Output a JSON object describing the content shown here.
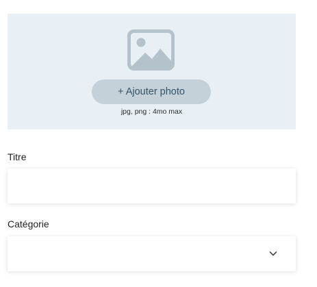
{
  "upload": {
    "icon": "image-placeholder-icon",
    "button_label": "+ Ajouter photo",
    "hint": "jpg, png : 4mo max"
  },
  "fields": {
    "title": {
      "label": "Titre",
      "value": ""
    },
    "category": {
      "label": "Catégorie",
      "selected": "",
      "icon": "chevron-down-icon"
    }
  },
  "colors": {
    "upload_background": "#e8f0f6",
    "button_background": "#c4d1d9",
    "button_text": "#33536a",
    "icon_color": "#b3c2cb"
  }
}
